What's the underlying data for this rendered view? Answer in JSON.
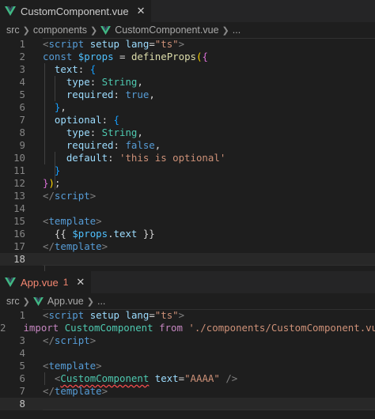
{
  "top_pane": {
    "tab": {
      "filename": "CustomComponent.vue",
      "close_glyph": "✕"
    },
    "breadcrumb": [
      "src",
      "components",
      "CustomComponent.vue",
      "..."
    ],
    "lines": [
      {
        "n": "1"
      },
      {
        "n": "2"
      },
      {
        "n": "3"
      },
      {
        "n": "4"
      },
      {
        "n": "5"
      },
      {
        "n": "6"
      },
      {
        "n": "7"
      },
      {
        "n": "8"
      },
      {
        "n": "9"
      },
      {
        "n": "10"
      },
      {
        "n": "11"
      },
      {
        "n": "12"
      },
      {
        "n": "13"
      },
      {
        "n": "14"
      },
      {
        "n": "15"
      },
      {
        "n": "16"
      },
      {
        "n": "17"
      },
      {
        "n": "18"
      }
    ]
  },
  "bottom_pane": {
    "tab": {
      "filename": "App.vue",
      "problem_count": "1",
      "close_glyph": "✕"
    },
    "breadcrumb": [
      "src",
      "App.vue",
      "..."
    ],
    "lines": [
      {
        "n": "1"
      },
      {
        "n": "2"
      },
      {
        "n": "3"
      },
      {
        "n": "4"
      },
      {
        "n": "5"
      },
      {
        "n": "6"
      },
      {
        "n": "7"
      },
      {
        "n": "8"
      }
    ]
  },
  "colors": {
    "vue_green": "#41b883",
    "vue_dark": "#35495e",
    "error": "#f48771"
  },
  "icons": [
    "vue-file-icon",
    "chevron-right-icon",
    "close-icon"
  ]
}
